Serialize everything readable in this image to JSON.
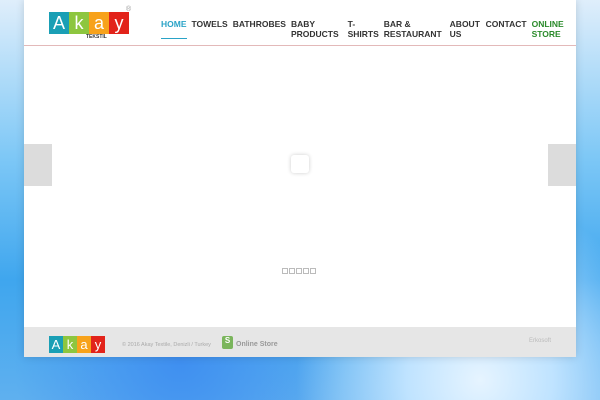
{
  "logo": {
    "letters": [
      "A",
      "k",
      "a",
      "y"
    ],
    "sub": "TEKSTIL",
    "reg": "®",
    "colors": [
      "#1a9fb5",
      "#8dc63f",
      "#f7a21b",
      "#e2231a"
    ]
  },
  "nav": [
    {
      "label": "HOME"
    },
    {
      "label": "TOWELS"
    },
    {
      "label": "BATHROBES"
    },
    {
      "label": "BABY PRODUCTS"
    },
    {
      "label": "T-SHIRTS"
    },
    {
      "label": "BAR & RESTAURANT"
    },
    {
      "label": "ABOUT US"
    },
    {
      "label": "CONTACT"
    },
    {
      "label": "ONLINE STORE"
    }
  ],
  "footer": {
    "copyright": "© 2016 Akay Textile, Denizli / Turkey",
    "shop_icon": "S",
    "online_store": "Online Store",
    "credit": "Erkosoft"
  }
}
